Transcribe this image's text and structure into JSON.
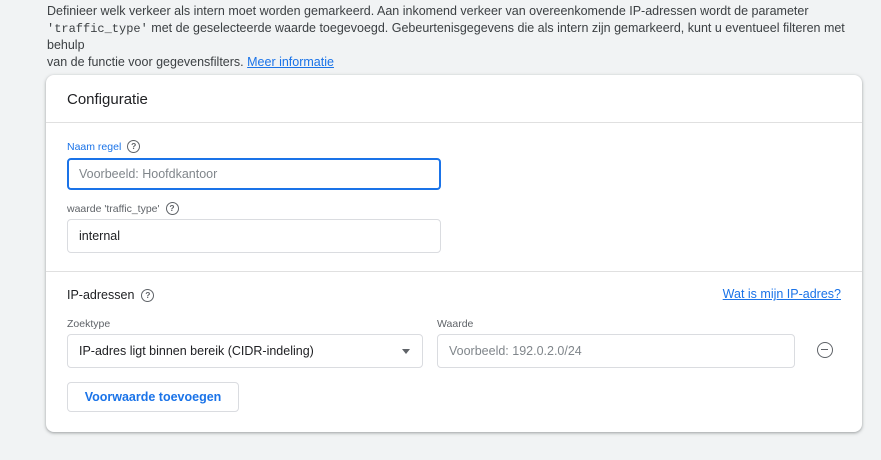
{
  "intro": {
    "line1": "Definieer welk verkeer als intern moet worden gemarkeerd. Aan inkomend verkeer van overeenkomende IP-adressen wordt de parameter",
    "code": "'traffic_type'",
    "line2_rest": " met de geselecteerde waarde toegevoegd. Gebeurtenisgegevens die als intern zijn gemarkeerd, kunt u eventueel filteren met behulp",
    "line3": "van de functie voor gegevensfilters. ",
    "link": "Meer informatie"
  },
  "card": {
    "title": "Configuratie",
    "rule_name": {
      "label": "Naam regel",
      "placeholder": "Voorbeeld: Hoofdkantoor",
      "value": ""
    },
    "traffic_type": {
      "label": "waarde 'traffic_type'",
      "value": "internal"
    },
    "ip_section": {
      "title": "IP-adressen",
      "what_is_my_ip": "Wat is mijn IP-adres?",
      "match_type_label": "Zoektype",
      "match_type_value": "IP-adres ligt binnen bereik (CIDR-indeling)",
      "value_label": "Waarde",
      "value_placeholder": "Voorbeeld: 192.0.2.0/24"
    },
    "add_condition": "Voorwaarde toevoegen"
  },
  "colors": {
    "accent": "#1a73e8",
    "background": "#f1f3f4",
    "card": "#ffffff",
    "text_secondary": "#5f6368"
  }
}
